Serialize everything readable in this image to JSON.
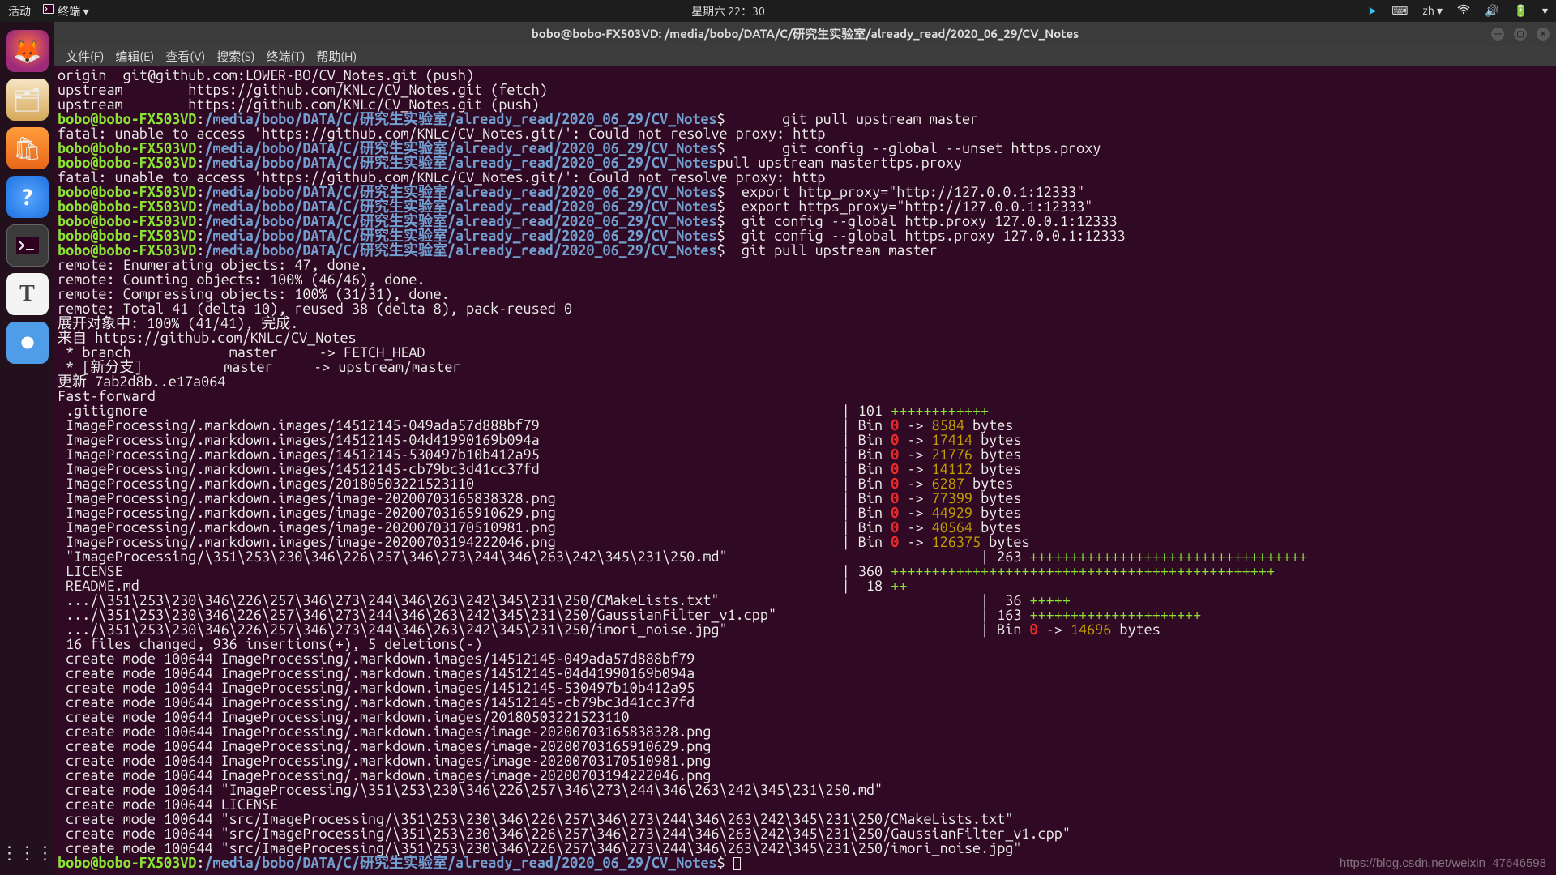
{
  "topbar": {
    "activities": "活动",
    "app": "终端",
    "arrow": "▾",
    "clock": "星期六 22：30",
    "lang": "zh ▾"
  },
  "title": "bobo@bobo-FX503VD: /media/bobo/DATA/C/研究生实验室/already_read/2020_06_29/CV_Notes",
  "menu": {
    "file": "文件(F)",
    "edit": "编辑(E)",
    "view": "查看(V)",
    "search": "搜索(S)",
    "term": "终端(T)",
    "help": "帮助(H)"
  },
  "prompt": {
    "user": "bobo@bobo-FX503VD",
    "sep": ":",
    "path": "/media/bobo/DATA/C/研究生实验室/already_read/2020_06_29/CV_Notes",
    "dollar": "$ "
  },
  "body": {
    "l1": "origin  git@github.com:LOWER-BO/CV_Notes.git (push)",
    "l2": "upstream        https://github.com/KNLc/CV_Notes.git (fetch)",
    "l3": "upstream        https://github.com/KNLc/CV_Notes.git (push)",
    "cmd1": "      git pull upstream master",
    "l4": "fatal: unable to access 'https://github.com/KNLc/CV_Notes.git/': Could not resolve proxy: http",
    "cmd2": "      git config --global --unset https.proxy",
    "cmd2b": "pull upstream masterttps.proxy",
    "l5": "fatal: unable to access 'https://github.com/KNLc/CV_Notes.git/': Could not resolve proxy: http",
    "cmd3": " export http_proxy=\"http://127.0.0.1:12333\"",
    "cmd4": " export https_proxy=\"http://127.0.0.1:12333\"",
    "cmd5": " git config --global http.proxy 127.0.0.1:12333",
    "cmd6": " git config --global https.proxy 127.0.0.1:12333",
    "cmd7": " git pull upstream master",
    "r1": "remote: Enumerating objects: 47, done.",
    "r2": "remote: Counting objects: 100% (46/46), done.",
    "r3": "remote: Compressing objects: 100% (31/31), done.",
    "r4": "remote: Total 41 (delta 10), reused 38 (delta 8), pack-reused 0",
    "r5": "展开对象中: 100% (41/41), 完成.",
    "r6": "来自 https://github.com/KNLc/CV_Notes",
    "r7": " * branch            master     -> FETCH_HEAD",
    "r8": " * [新分支]          master     -> upstream/master",
    "r9": "更新 7ab2d8b..e17a064",
    "r10": "Fast-forward",
    "diff": [
      {
        "f": " .gitignore                                                                                     | 101 ",
        "p": "++++++++++++"
      },
      {
        "f": " ImageProcessing/.markdown.images/14512145-049ada57d888bf79                                     | Bin ",
        "z": "0",
        "a": " -> ",
        "n": "8584",
        "b": " bytes"
      },
      {
        "f": " ImageProcessing/.markdown.images/14512145-04d41990169b094a                                     | Bin ",
        "z": "0",
        "a": " -> ",
        "n": "17414",
        "b": " bytes"
      },
      {
        "f": " ImageProcessing/.markdown.images/14512145-530497b10b412a95                                     | Bin ",
        "z": "0",
        "a": " -> ",
        "n": "21776",
        "b": " bytes"
      },
      {
        "f": " ImageProcessing/.markdown.images/14512145-cb79bc3d41cc37fd                                     | Bin ",
        "z": "0",
        "a": " -> ",
        "n": "14112",
        "b": " bytes"
      },
      {
        "f": " ImageProcessing/.markdown.images/20180503221523110                                             | Bin ",
        "z": "0",
        "a": " -> ",
        "n": "6287",
        "b": " bytes"
      },
      {
        "f": " ImageProcessing/.markdown.images/image-20200703165838328.png                                   | Bin ",
        "z": "0",
        "a": " -> ",
        "n": "77399",
        "b": " bytes"
      },
      {
        "f": " ImageProcessing/.markdown.images/image-20200703165910629.png                                   | Bin ",
        "z": "0",
        "a": " -> ",
        "n": "44929",
        "b": " bytes"
      },
      {
        "f": " ImageProcessing/.markdown.images/image-20200703170510981.png                                   | Bin ",
        "z": "0",
        "a": " -> ",
        "n": "40564",
        "b": " bytes"
      },
      {
        "f": " ImageProcessing/.markdown.images/image-20200703194222046.png                                   | Bin ",
        "z": "0",
        "a": " -> ",
        "n": "126375",
        "b": " bytes"
      },
      {
        "f": " \"ImageProcessing/\\351\\253\\230\\346\\226\\257\\346\\273\\244\\346\\263\\242\\345\\231\\250.md\"                               | 263 ",
        "p": "++++++++++++++++++++++++++++++++++"
      },
      {
        "f": " LICENSE                                                                                        | 360 ",
        "p": "+++++++++++++++++++++++++++++++++++++++++++++++"
      },
      {
        "f": " README.md                                                                                      |  18 ",
        "p": "++"
      },
      {
        "f": " .../\\351\\253\\230\\346\\226\\257\\346\\273\\244\\346\\263\\242\\345\\231\\250/CMakeLists.txt\"                                |  36 ",
        "p": "+++++"
      },
      {
        "f": " .../\\351\\253\\230\\346\\226\\257\\346\\273\\244\\346\\263\\242\\345\\231\\250/GaussianFilter_v1.cpp\"                         | 163 ",
        "p": "+++++++++++++++++++++"
      },
      {
        "f": " .../\\351\\253\\230\\346\\226\\257\\346\\273\\244\\346\\263\\242\\345\\231\\250/imori_noise.jpg\"                               | Bin ",
        "z": "0",
        "a": " -> ",
        "n": "14696",
        "b": " bytes"
      }
    ],
    "summary": " 16 files changed, 936 insertions(+), 5 deletions(-)",
    "create": [
      " create mode 100644 ImageProcessing/.markdown.images/14512145-049ada57d888bf79",
      " create mode 100644 ImageProcessing/.markdown.images/14512145-04d41990169b094a",
      " create mode 100644 ImageProcessing/.markdown.images/14512145-530497b10b412a95",
      " create mode 100644 ImageProcessing/.markdown.images/14512145-cb79bc3d41cc37fd",
      " create mode 100644 ImageProcessing/.markdown.images/20180503221523110",
      " create mode 100644 ImageProcessing/.markdown.images/image-20200703165838328.png",
      " create mode 100644 ImageProcessing/.markdown.images/image-20200703165910629.png",
      " create mode 100644 ImageProcessing/.markdown.images/image-20200703170510981.png",
      " create mode 100644 ImageProcessing/.markdown.images/image-20200703194222046.png",
      " create mode 100644 \"ImageProcessing/\\351\\253\\230\\346\\226\\257\\346\\273\\244\\346\\263\\242\\345\\231\\250.md\"",
      " create mode 100644 LICENSE",
      " create mode 100644 \"src/ImageProcessing/\\351\\253\\230\\346\\226\\257\\346\\273\\244\\346\\263\\242\\345\\231\\250/CMakeLists.txt\"",
      " create mode 100644 \"src/ImageProcessing/\\351\\253\\230\\346\\226\\257\\346\\273\\244\\346\\263\\242\\345\\231\\250/GaussianFilter_v1.cpp\"",
      " create mode 100644 \"src/ImageProcessing/\\351\\253\\230\\346\\226\\257\\346\\273\\244\\346\\263\\242\\345\\231\\250/imori_noise.jpg\""
    ]
  },
  "watermark": "https://blog.csdn.net/weixin_47646598"
}
